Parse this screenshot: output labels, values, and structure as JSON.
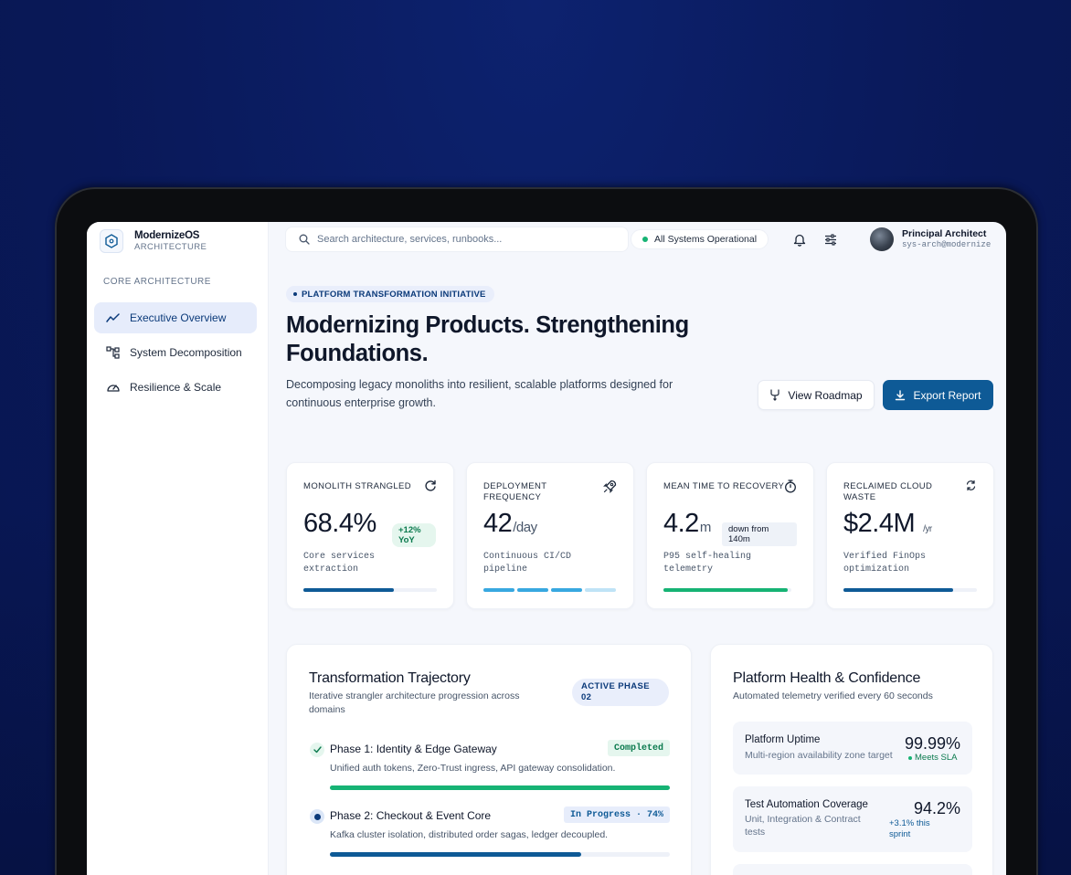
{
  "app": {
    "name": "ModernizeOS",
    "subtitle": "ARCHITECTURE"
  },
  "sidebar": {
    "heading": "CORE ARCHITECTURE",
    "items": [
      {
        "label": "Executive Overview",
        "icon": "trend-icon",
        "active": true
      },
      {
        "label": "System Decomposition",
        "icon": "hierarchy-icon",
        "active": false
      },
      {
        "label": "Resilience & Scale",
        "icon": "gauge-icon",
        "active": false
      }
    ]
  },
  "search": {
    "placeholder": "Search architecture, services, runbooks...",
    "value": ""
  },
  "status": {
    "label": "All Systems Operational",
    "color": "#16b374"
  },
  "user": {
    "name": "Principal Architect",
    "id": "sys-arch@modernize"
  },
  "hero": {
    "badge": "PLATFORM TRANSFORMATION INITIATIVE",
    "title": "Modernizing Products. Strengthening Foundations.",
    "description": "Decomposing legacy monoliths into resilient, scalable platforms designed for continuous enterprise growth.",
    "btn_roadmap": "View Roadmap",
    "btn_export": "Export Report"
  },
  "kpis": [
    {
      "label": "MONOLITH STRANGLED",
      "value": "68.4%",
      "chip": "+12% YoY",
      "sub": "Core services extraction",
      "progress": 0.68,
      "color": "#0e5a96",
      "icon": "refresh-icon"
    },
    {
      "label": "DEPLOYMENT FREQUENCY",
      "value": "42",
      "unit": "/day",
      "sub": "Continuous CI/CD pipeline",
      "segments": 4,
      "segments_filled": 3,
      "color": "#38a8e0",
      "icon": "rocket-icon"
    },
    {
      "label": "MEAN TIME TO RECOVERY",
      "value": "4.2",
      "unit": "m",
      "chip": "down from 140m",
      "sub": "P95 self-healing telemetry",
      "progress": 0.97,
      "color": "#16b374",
      "icon": "stopwatch-icon"
    },
    {
      "label": "RECLAIMED CLOUD WASTE",
      "value": "$2.4M",
      "unit": "/yr",
      "sub": "Verified FinOps optimization",
      "progress": 0.82,
      "color": "#0e5a96",
      "icon": "recycle-icon"
    }
  ],
  "trajectory": {
    "title": "Transformation Trajectory",
    "subtitle": "Iterative strangler architecture progression across domains",
    "phase_pill": "ACTIVE PHASE 02",
    "phases": [
      {
        "title": "Phase 1: Identity & Edge Gateway",
        "desc": "Unified auth tokens, Zero-Trust ingress, API gateway consolidation.",
        "tag": "Completed",
        "progress": 1.0,
        "color": "#16b374"
      },
      {
        "title": "Phase 2: Checkout & Event Core",
        "desc": "Kafka cluster isolation, distributed order sagas, ledger decoupled.",
        "tag": "In Progress · 74%",
        "progress": 0.74,
        "color": "#0e5a96"
      }
    ]
  },
  "health": {
    "title": "Platform Health & Confidence",
    "subtitle": "Automated telemetry verified every 60 seconds",
    "metrics": [
      {
        "name": "Platform Uptime",
        "desc": "Multi-region availability zone target",
        "value": "99.99%",
        "note": "Meets SLA"
      },
      {
        "name": "Test Automation Coverage",
        "desc": "Unit, Integration & Contract tests",
        "value": "94.2%",
        "note": "+3.1% this sprint"
      }
    ]
  }
}
